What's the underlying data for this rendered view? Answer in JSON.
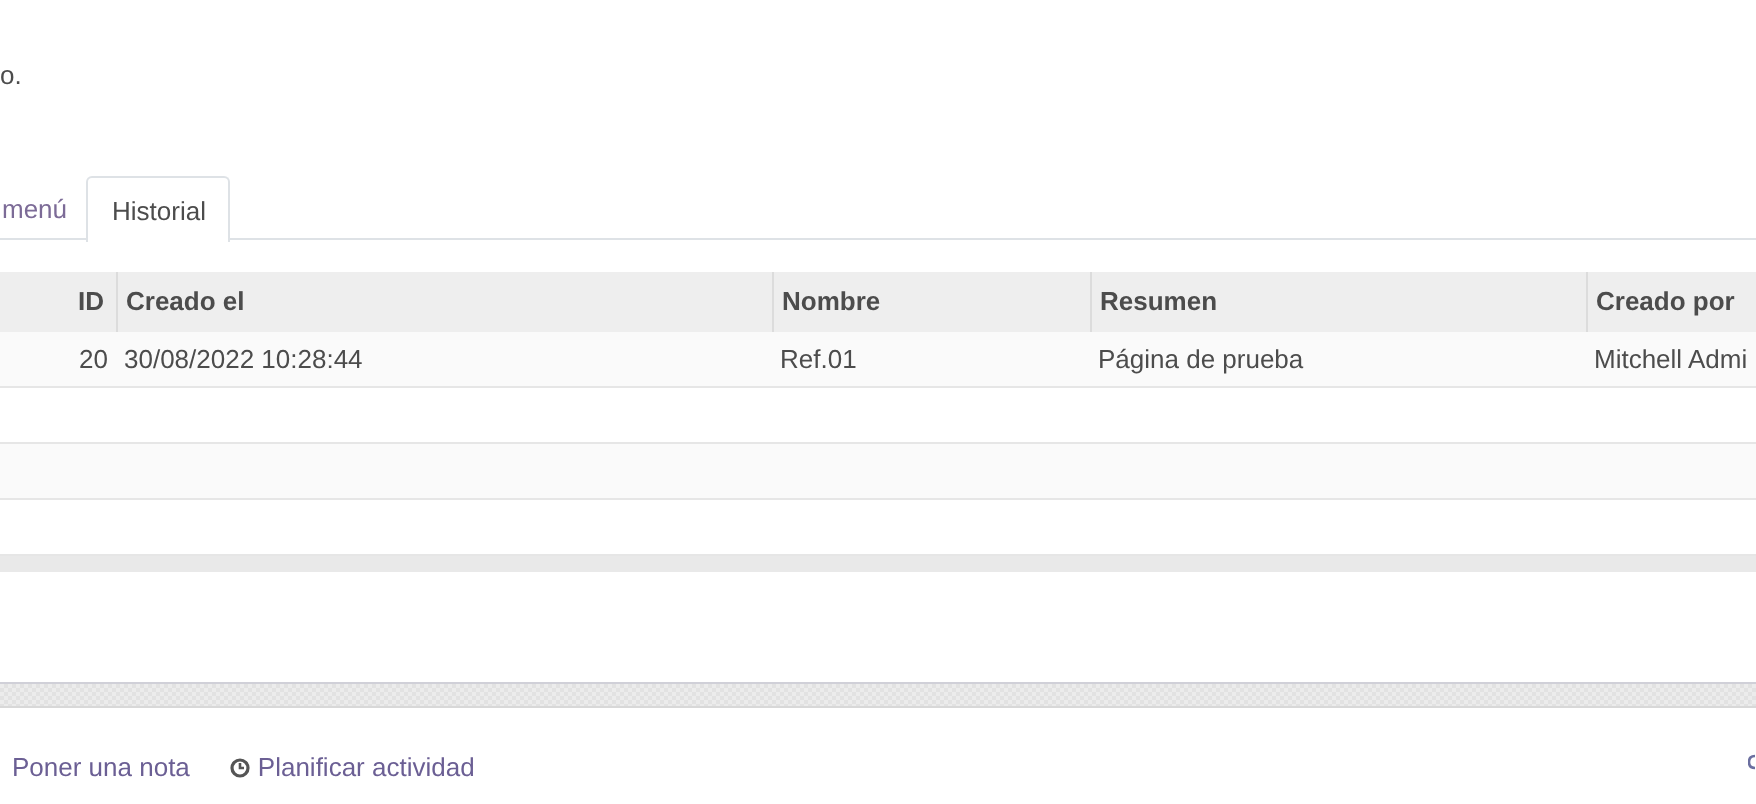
{
  "description": "o.",
  "tabs": [
    {
      "label": "menú",
      "selected": false
    },
    {
      "label": "Historial",
      "selected": true
    }
  ],
  "table": {
    "columns": [
      "ID",
      "Creado el",
      "Nombre",
      "Resumen",
      "Creado por"
    ],
    "rows": [
      [
        "20",
        "30/08/2022 10:28:44",
        "Ref.01",
        "Página de prueba",
        "Mitchell Admi"
      ]
    ]
  },
  "chatter": {
    "actions": [
      {
        "label": "Poner una nota",
        "kind": "plain"
      },
      {
        "label": "Planificar actividad",
        "kind": "clock"
      }
    ]
  }
}
